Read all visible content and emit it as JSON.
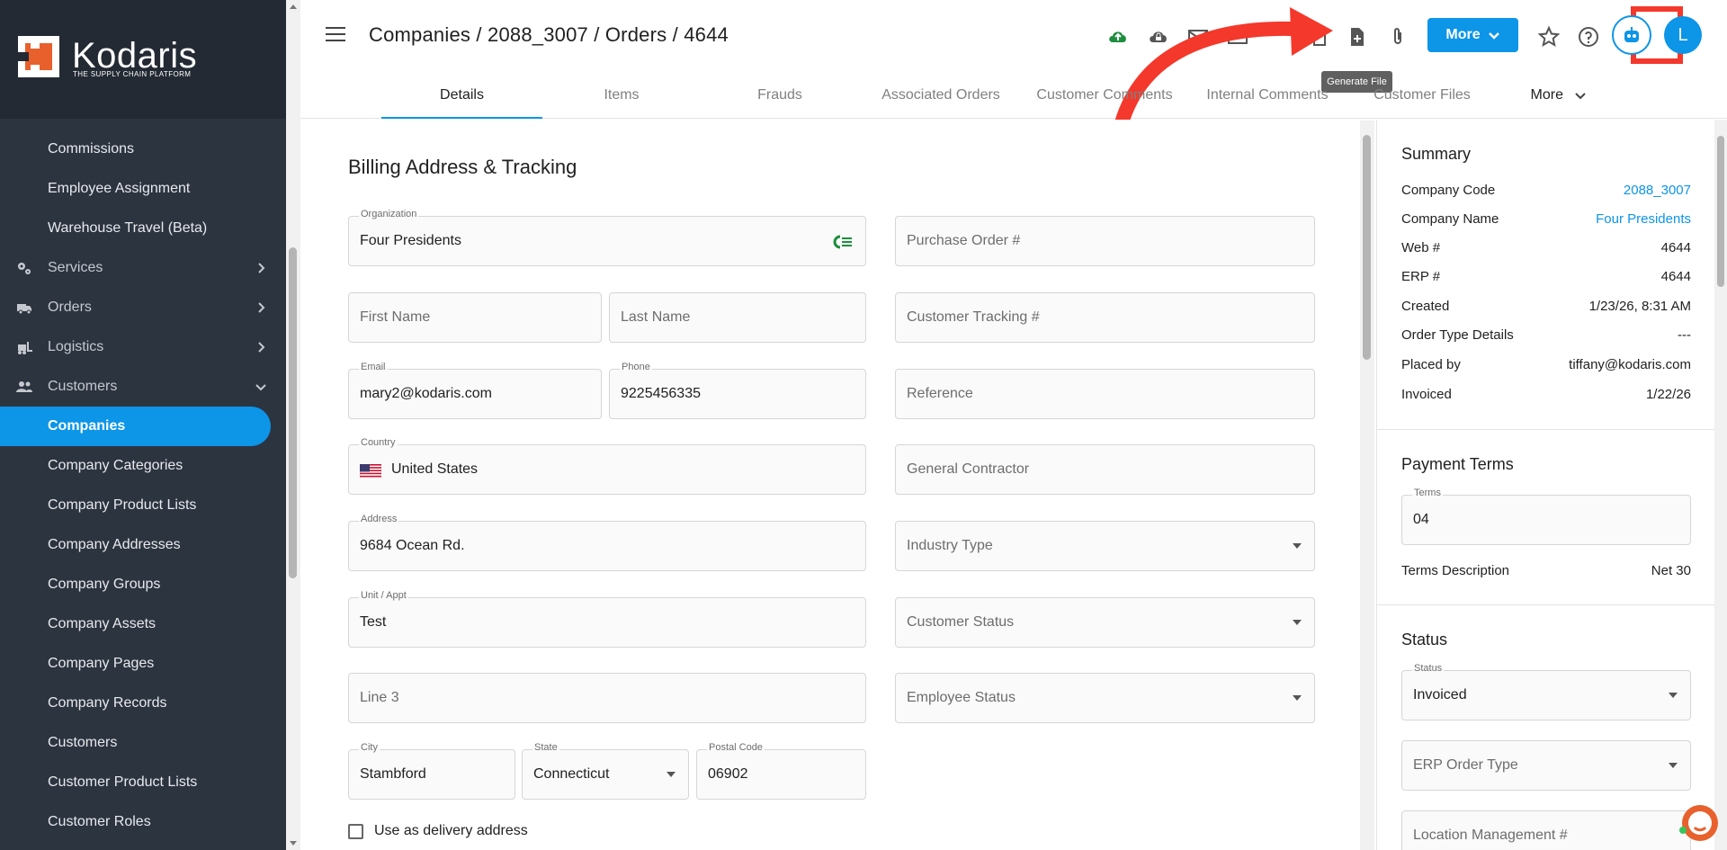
{
  "brand": {
    "name": "Kodaris",
    "tagline": "THE SUPPLY CHAIN PLATFORM"
  },
  "colors": {
    "accent": "#0d95e8",
    "sidebar": "#2c3440",
    "highlight": "#f4382b",
    "success": "#1e8e3e"
  },
  "sidebar": {
    "items": [
      {
        "label": "Commissions",
        "kind": "sub"
      },
      {
        "label": "Employee Assignment",
        "kind": "sub"
      },
      {
        "label": "Warehouse Travel (Beta)",
        "kind": "sub"
      },
      {
        "label": "Services",
        "kind": "top",
        "icon": "gears-icon",
        "chevron": "right"
      },
      {
        "label": "Orders",
        "kind": "top",
        "icon": "truck-icon",
        "chevron": "right"
      },
      {
        "label": "Logistics",
        "kind": "top",
        "icon": "forklift-icon",
        "chevron": "right"
      },
      {
        "label": "Customers",
        "kind": "top",
        "icon": "people-icon",
        "chevron": "down"
      },
      {
        "label": "Companies",
        "kind": "sub",
        "active": true
      },
      {
        "label": "Company Categories",
        "kind": "sub"
      },
      {
        "label": "Company Product Lists",
        "kind": "sub"
      },
      {
        "label": "Company Addresses",
        "kind": "sub"
      },
      {
        "label": "Company Groups",
        "kind": "sub"
      },
      {
        "label": "Company Assets",
        "kind": "sub"
      },
      {
        "label": "Company Pages",
        "kind": "sub"
      },
      {
        "label": "Company Records",
        "kind": "sub"
      },
      {
        "label": "Customers",
        "kind": "sub"
      },
      {
        "label": "Customer Product Lists",
        "kind": "sub"
      },
      {
        "label": "Customer Roles",
        "kind": "sub"
      }
    ]
  },
  "header": {
    "breadcrumb": "Companies / 2088_3007 / Orders / 4644",
    "more_label": "More",
    "avatar_initial": "L",
    "tooltip": "Generate File",
    "icons": [
      "cloud-upload-icon",
      "cloud-lock-icon",
      "mail-icon",
      "mail-icon",
      "copy-icon",
      "generate-file-icon",
      "attachment-icon",
      "star-icon",
      "help-icon",
      "bot-icon"
    ]
  },
  "tabs": [
    {
      "label": "Details",
      "active": true
    },
    {
      "label": "Items"
    },
    {
      "label": "Frauds"
    },
    {
      "label": "Associated Orders"
    },
    {
      "label": "Customer Comments"
    },
    {
      "label": "Internal Comments"
    },
    {
      "label": "Customer Files"
    },
    {
      "label": "More"
    }
  ],
  "form": {
    "title": "Billing Address & Tracking",
    "organization": {
      "label": "Organization",
      "value": "Four Presidents"
    },
    "first_name": {
      "placeholder": "First Name"
    },
    "last_name": {
      "placeholder": "Last Name"
    },
    "email": {
      "label": "Email",
      "value": "mary2@kodaris.com"
    },
    "phone": {
      "label": "Phone",
      "value": "9225456335"
    },
    "country": {
      "label": "Country",
      "value": "United States"
    },
    "address": {
      "label": "Address",
      "value": "9684 Ocean Rd."
    },
    "unit": {
      "label": "Unit / Appt",
      "value": "Test"
    },
    "line3": {
      "placeholder": "Line 3"
    },
    "city": {
      "label": "City",
      "value": "Stambford"
    },
    "state": {
      "label": "State",
      "value": "Connecticut"
    },
    "postal": {
      "label": "Postal Code",
      "value": "06902"
    },
    "purchase_order": {
      "placeholder": "Purchase Order #"
    },
    "customer_tracking": {
      "placeholder": "Customer Tracking #"
    },
    "reference": {
      "placeholder": "Reference"
    },
    "general_contractor": {
      "placeholder": "General Contractor"
    },
    "industry_type": {
      "placeholder": "Industry Type"
    },
    "customer_status": {
      "placeholder": "Customer Status"
    },
    "employee_status": {
      "placeholder": "Employee Status"
    },
    "use_as_delivery": "Use as delivery address"
  },
  "summary": {
    "title": "Summary",
    "rows": [
      {
        "key": "Company Code",
        "value": "2088_3007",
        "link": true
      },
      {
        "key": "Company Name",
        "value": "Four Presidents",
        "link": true
      },
      {
        "key": "Web #",
        "value": "4644"
      },
      {
        "key": "ERP #",
        "value": "4644"
      },
      {
        "key": "Created",
        "value": "1/23/26, 8:31 AM"
      },
      {
        "key": "Order Type Details",
        "value": "---"
      },
      {
        "key": "Placed by",
        "value": "tiffany@kodaris.com"
      },
      {
        "key": "Invoiced",
        "value": "1/22/26"
      }
    ]
  },
  "payment_terms": {
    "title": "Payment Terms",
    "terms_label": "Terms",
    "terms_value": "04",
    "description_key": "Terms Description",
    "description_value": "Net 30"
  },
  "status": {
    "title": "Status",
    "status_label": "Status",
    "status_value": "Invoiced",
    "erp_order_type": "ERP Order Type",
    "location_management": "Location Management #"
  }
}
